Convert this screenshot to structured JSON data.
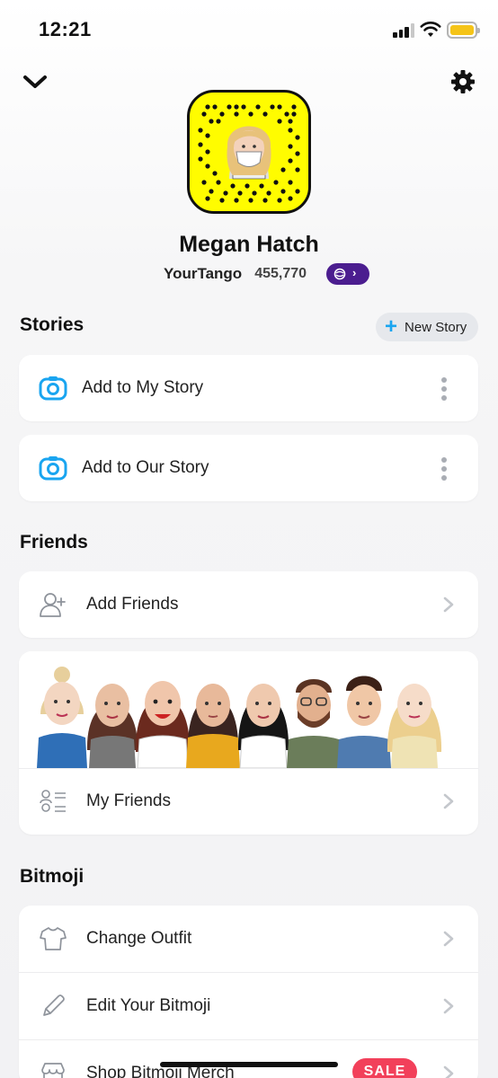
{
  "status_bar": {
    "time": "12:21"
  },
  "profile": {
    "name": "Megan Hatch",
    "username": "YourTango",
    "score": "455,770"
  },
  "stories": {
    "title": "Stories",
    "new_story_label": "New Story",
    "items": [
      {
        "label": "Add to My Story"
      },
      {
        "label": "Add to Our Story"
      }
    ]
  },
  "friends": {
    "title": "Friends",
    "add_friends_label": "Add Friends",
    "my_friends_label": "My Friends"
  },
  "bitmoji": {
    "title": "Bitmoji",
    "items": [
      {
        "label": "Change Outfit"
      },
      {
        "label": "Edit Your Bitmoji"
      },
      {
        "label": "Shop Bitmoji Merch",
        "badge": "SALE"
      }
    ]
  },
  "colors": {
    "snapchat_yellow": "#fffc00",
    "camera_blue": "#1aa5f0",
    "zodiac_purple": "#4b1d8f",
    "sale_red": "#f2405a"
  }
}
